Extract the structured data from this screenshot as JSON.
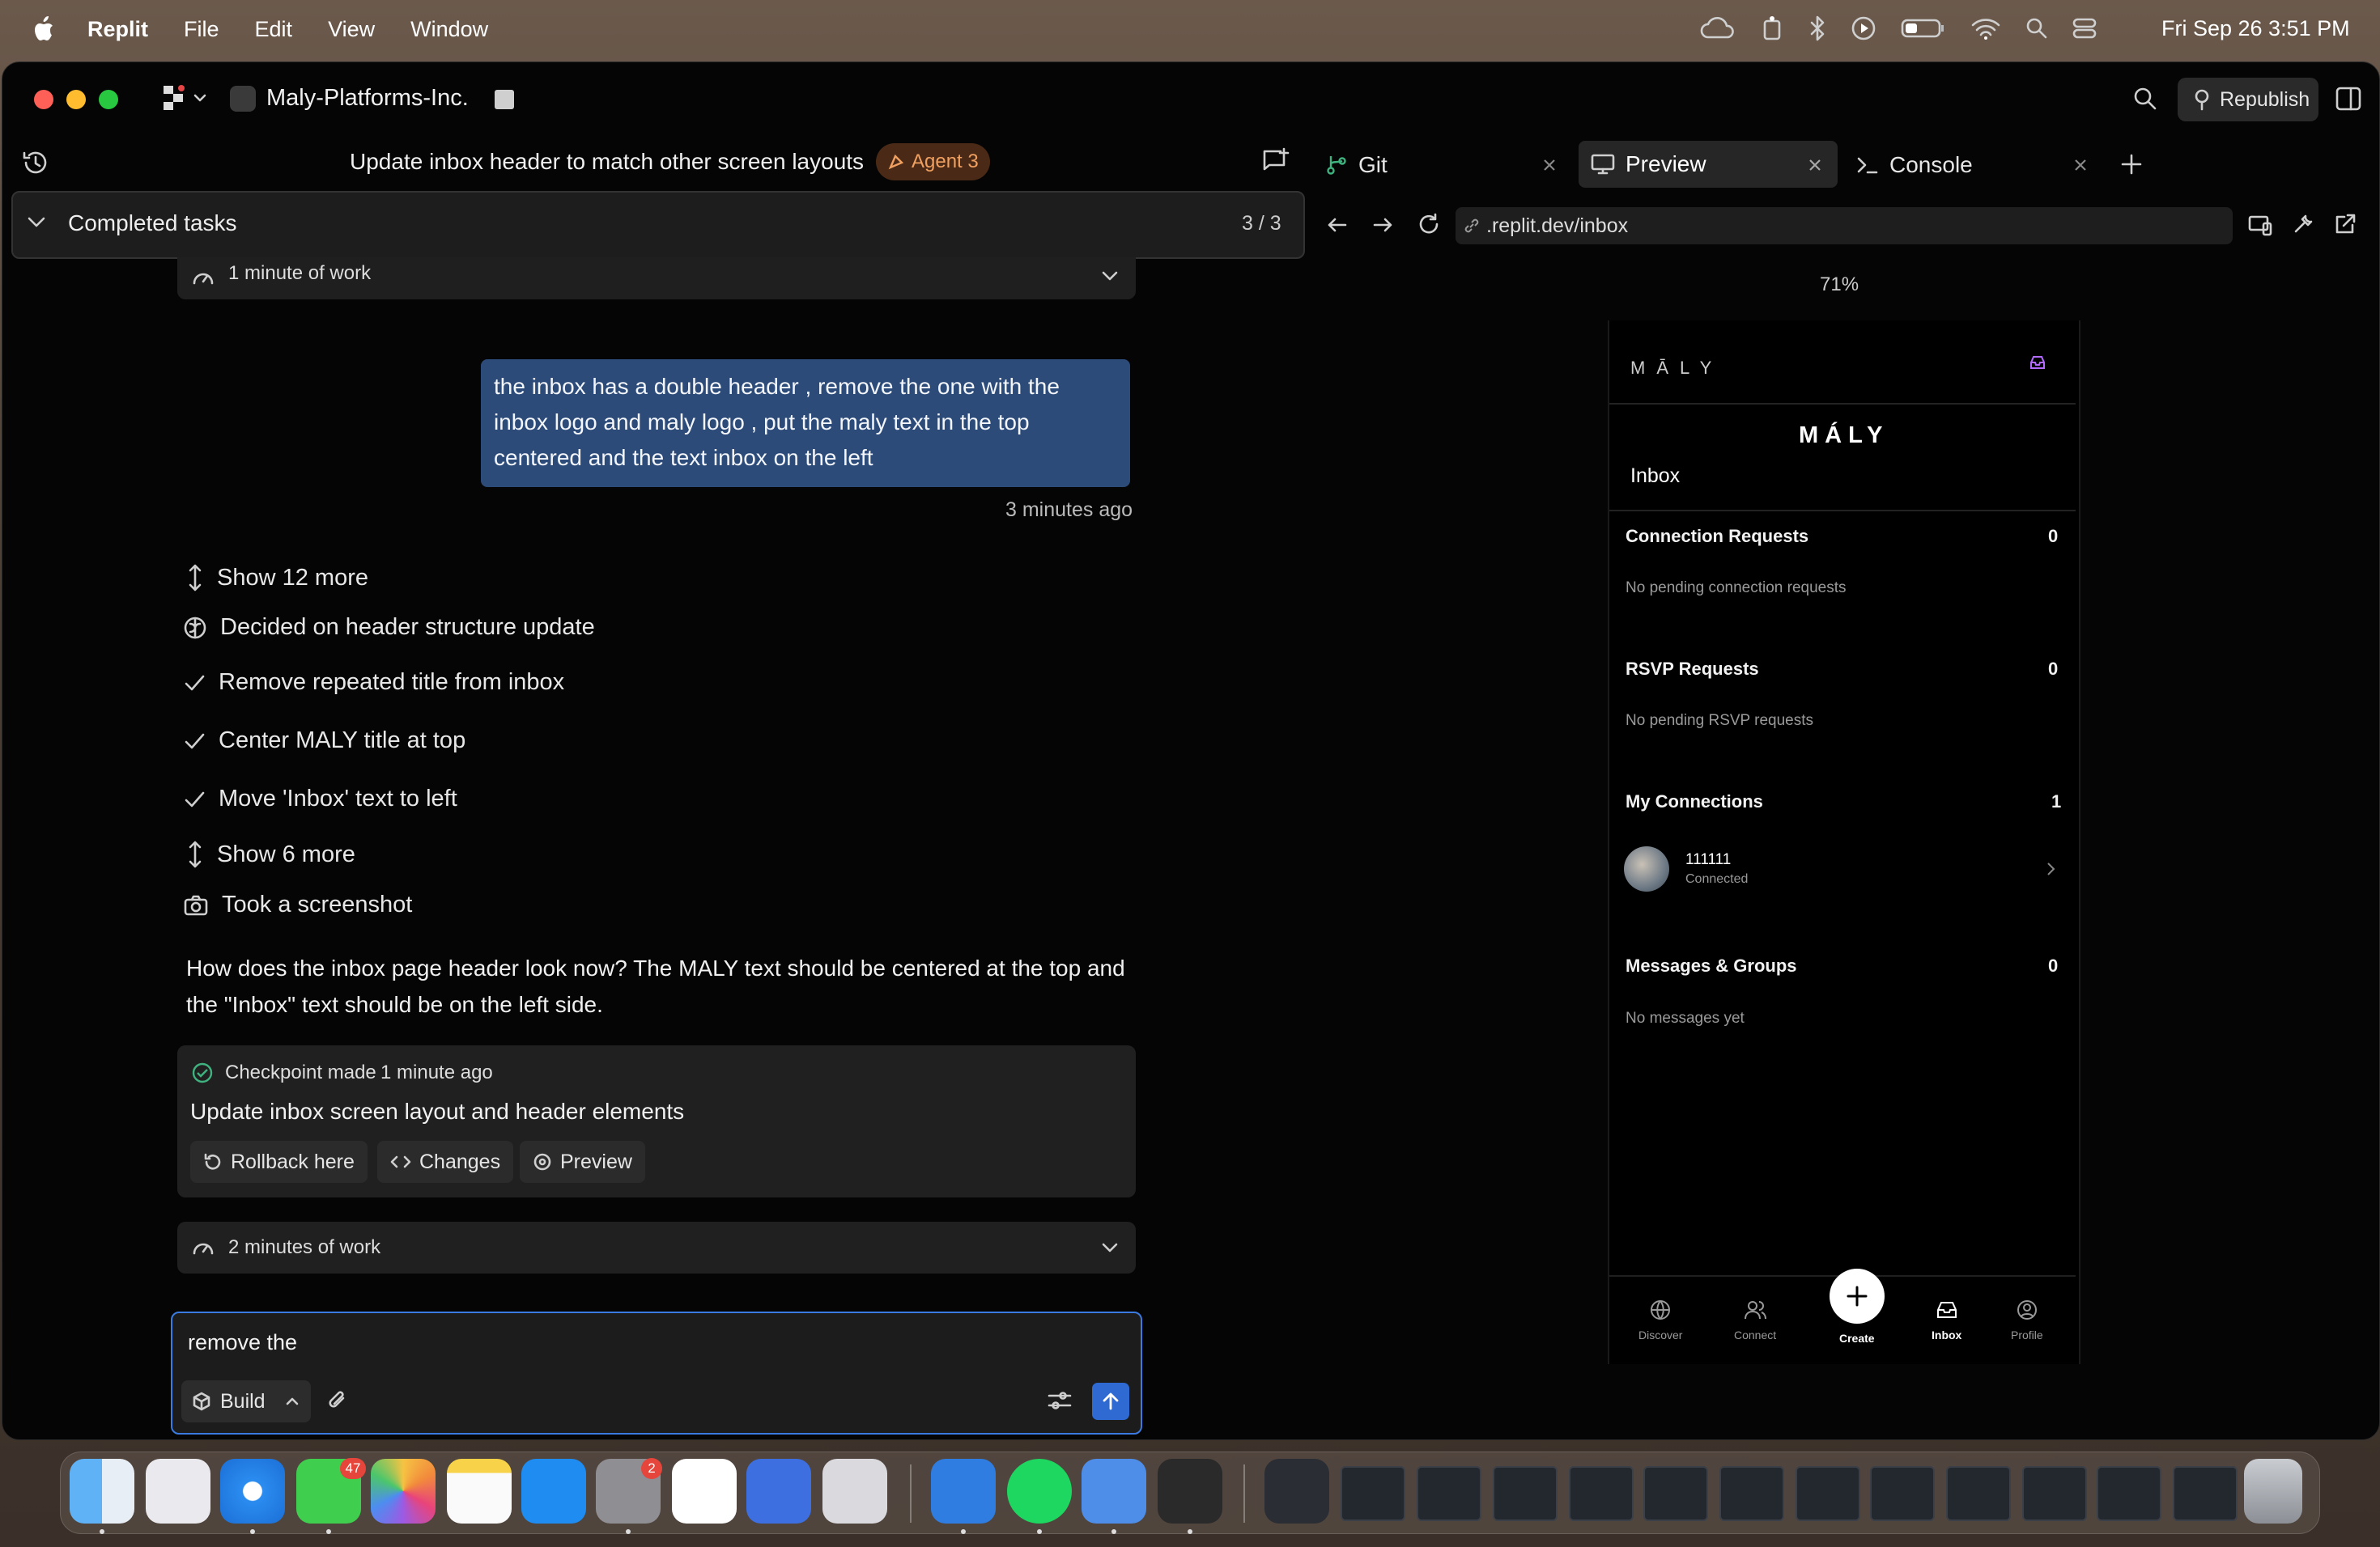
{
  "menubar": {
    "app_name": "Replit",
    "menus": [
      "File",
      "Edit",
      "View",
      "Window"
    ],
    "clock": "Fri Sep 26  3:51 PM"
  },
  "window": {
    "workspace_name": "Maly-Platforms-Inc.",
    "republish_label": "Republish"
  },
  "chat": {
    "task_title": "Update inbox header to match other screen layouts",
    "agent_badge": "Agent 3",
    "completed_tasks_label": "Completed tasks",
    "completed_tasks_count": "3 / 3",
    "work_summary_top": "1 minute of work",
    "user_message": "the inbox has a double header , remove the one with the inbox logo and maly logo , put the maly text in the top centered and the text inbox on the left",
    "user_message_time": "3 minutes ago",
    "steps": {
      "show_more_1": "Show 12 more",
      "decided": "Decided on header structure update",
      "task1": "Remove repeated title from inbox",
      "task2": "Center MALY title at top",
      "task3": "Move 'Inbox' text to left",
      "show_more_2": "Show 6 more",
      "screenshot": "Took a screenshot"
    },
    "agent_message": "How does the inbox page header look now? The MALY text should be centered at the top and the \"Inbox\" text should be on the left side.",
    "checkpoint": {
      "made_label": "Checkpoint made",
      "time": "1 minute ago",
      "title": "Update inbox screen layout and header elements",
      "rollback": "Rollback here",
      "changes": "Changes",
      "preview": "Preview"
    },
    "work_summary_bottom": "2 minutes of work",
    "input_value": "remove the",
    "mode_label": "Build"
  },
  "tabs": {
    "git": "Git",
    "preview": "Preview",
    "console": "Console"
  },
  "preview": {
    "url": ".replit.dev/inbox",
    "zoom": "71%",
    "app": {
      "logo_small": "MĀLY",
      "title": "MÁLY",
      "page_label": "Inbox",
      "sections": [
        {
          "label": "Connection Requests",
          "count": "0",
          "empty": "No pending connection requests"
        },
        {
          "label": "RSVP Requests",
          "count": "0",
          "empty": "No pending RSVP requests"
        },
        {
          "label": "My Connections",
          "count": "1"
        },
        {
          "label": "Messages & Groups",
          "count": "0",
          "empty": "No messages yet"
        }
      ],
      "connection": {
        "name": "111111",
        "status": "Connected"
      },
      "nav": [
        "Discover",
        "Connect",
        "Create",
        "Inbox",
        "Profile"
      ]
    }
  },
  "dock": {
    "messages_badge": "47",
    "settings_badge": "2"
  }
}
